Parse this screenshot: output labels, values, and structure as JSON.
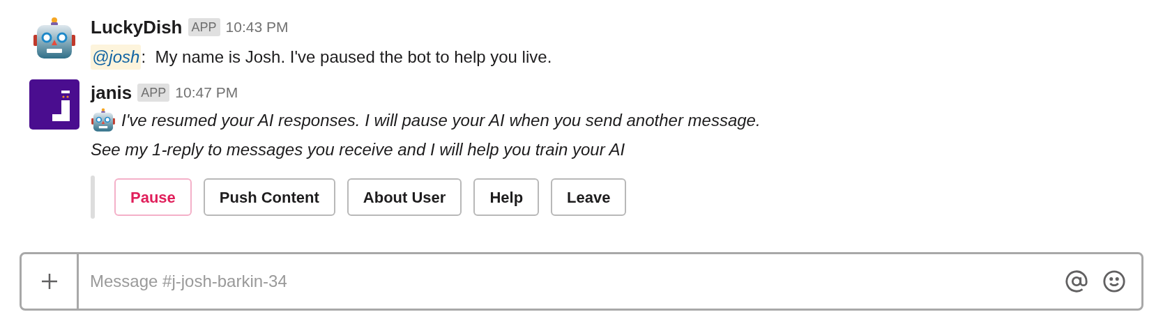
{
  "messages": [
    {
      "author": "LuckyDish",
      "badge": "APP",
      "time": "10:43 PM",
      "avatar": {
        "kind": "robot"
      },
      "mention": "@josh",
      "text": ":  My name is Josh. I've paused the bot to help you live."
    },
    {
      "author": "janis",
      "badge": "APP",
      "time": "10:47 PM",
      "avatar": {
        "kind": "janis"
      },
      "lines": [
        "I've resumed your AI responses. I will pause your AI when you send another message.",
        "See my 1-reply to messages you receive and I will help you train your AI"
      ],
      "buttons": [
        {
          "label": "Pause",
          "kind": "danger"
        },
        {
          "label": "Push Content",
          "kind": "default"
        },
        {
          "label": "About User",
          "kind": "default"
        },
        {
          "label": "Help",
          "kind": "default"
        },
        {
          "label": "Leave",
          "kind": "default"
        }
      ]
    }
  ],
  "composer": {
    "placeholder": "Message #j-josh-barkin-34"
  }
}
